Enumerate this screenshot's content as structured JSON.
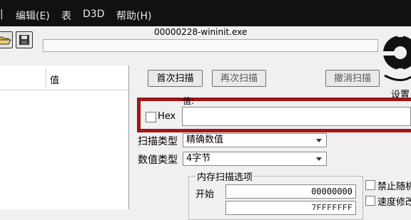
{
  "menu": {
    "edit": "编辑(E)",
    "table": "表",
    "d3d": "D3D",
    "help": "帮助(H)"
  },
  "process_title": "00000228-wininit.exe",
  "settings_label": "设置",
  "left_panel": {
    "value_col": "值"
  },
  "buttons": {
    "first_scan": "首次扫描",
    "next_scan": "再次扫描",
    "undo_scan": "撤消扫描"
  },
  "value_label": "值:",
  "hex_label": "Hex",
  "value_input": "",
  "scan_type": {
    "label": "扫描类型",
    "value": "精确数值"
  },
  "value_type": {
    "label": "数值类型",
    "value": "4字节"
  },
  "memory_options": {
    "title": "内存扫描选项",
    "start_label": "开始",
    "start_value": "00000000",
    "stop_value": "7FFFFFFF"
  },
  "checkboxes": {
    "disable_random": "禁止随机",
    "speed_modify": "速度修改"
  },
  "icons": {
    "open": "folder-open-icon",
    "save": "floppy-disk-icon",
    "logo": "cheat-engine-logo"
  }
}
